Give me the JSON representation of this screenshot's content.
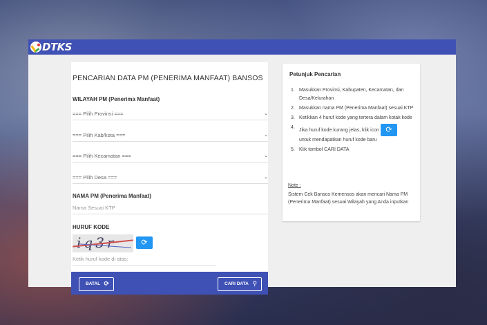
{
  "header": {
    "logo_text": "DTKS",
    "brand_color": "#3f51b5"
  },
  "form": {
    "title": "PENCARIAN DATA PM (PENERIMA MANFAAT) BANSOS",
    "wilayah_label": "WILAYAH PM (Penerima Manfaat)",
    "selects": [
      {
        "selected": "=== Pilih Provinsi ==="
      },
      {
        "selected": "=== Pilih Kab/kota ==="
      },
      {
        "selected": "=== Pilih Kecamatan ==="
      },
      {
        "selected": "=== Pilih Desa ==="
      }
    ],
    "nama_label": "NAMA PM (Penerima Manfaat)",
    "nama_placeholder": "Nama Sesuai KTP",
    "kode_label": "HURUF KODE",
    "captcha_text": "iq3r",
    "kode_placeholder": "Ketik huruf kode di atas:",
    "cancel_label": "BATAL",
    "search_label": "CARI DATA",
    "accent_color": "#2196f3"
  },
  "instructions": {
    "title": "Petunjuk Pencarian",
    "steps": [
      "Masukkan Provinsi, Kabupaten, Kecamatan, dan Desa/Kelurahan",
      "Masukkan nama PM (Penerima Manfaat) sesuai KTP",
      "Ketikkan 4 huruf kode yang tertera dalam kotak kode",
      "Jika huruf kode kurang jelas, klik icon",
      "Klik tombol CARI DATA"
    ],
    "step4_suffix": "untuk mendapatkan huruf kode baru",
    "note_label": "Note :",
    "note_text": "Sistem Cek Bansos Kemensos akan mencari Nama PM (Penerima Manfaat) sesuai Wilayah yang Anda inputkan"
  }
}
